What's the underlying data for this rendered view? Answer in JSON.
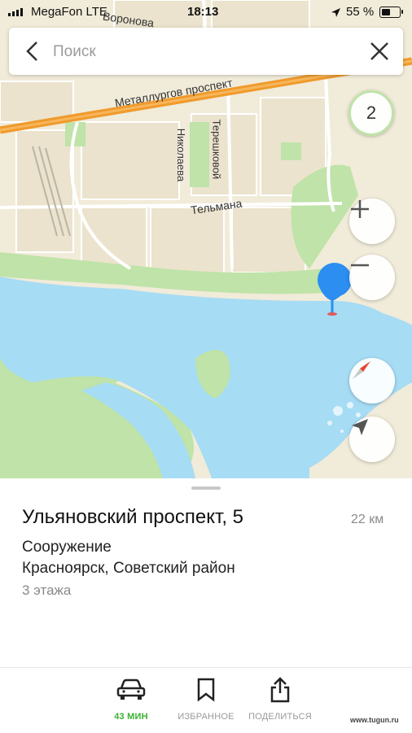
{
  "status_bar": {
    "carrier": "MegaFon LTE",
    "time": "18:13",
    "battery": "55 %"
  },
  "search": {
    "placeholder": "Поиск"
  },
  "map": {
    "streets": {
      "metallurgov": "Металлургов проспект",
      "nikolaeva": "Николаева",
      "tereshkovoy": "Терешковой",
      "telmana": "Тельмана",
      "voronova": "Воронова"
    },
    "layers_count": "2",
    "colors": {
      "land": "#f1ebd9",
      "water": "#a6dcf4",
      "park": "#bfe3a8",
      "road_major": "#f09a2c",
      "marker": "#2b8ef0"
    }
  },
  "place": {
    "title": "Ульяновский проспект, 5",
    "distance": "22 км",
    "type": "Сооружение",
    "address": "Красноярск, Советский район",
    "floors": "3 этажа"
  },
  "actions": {
    "route_label": "43 МИН",
    "favorites_label": "ИЗБРАННОЕ",
    "share_label": "ПОДЕЛИТЬСЯ"
  },
  "watermark": "www.tugun.ru"
}
